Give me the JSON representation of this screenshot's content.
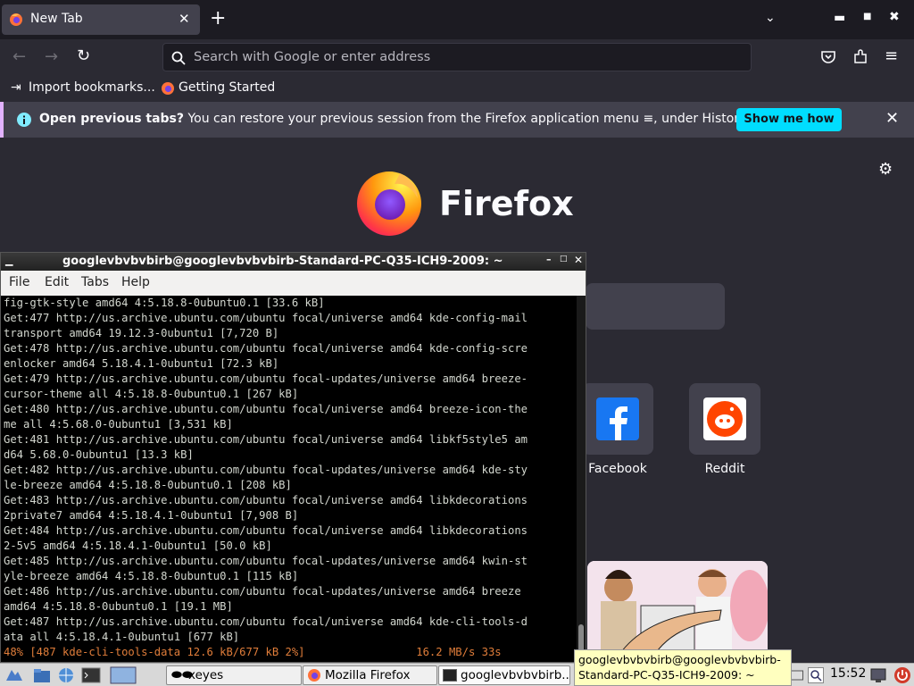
{
  "browser": {
    "tab_title": "New Tab",
    "search_placeholder": "Search with Google or enter address",
    "bookmarks": [
      "Import bookmarks...",
      "Getting Started"
    ],
    "notice": {
      "bold": "Open previous tabs?",
      "text": " You can restore your previous session from the Firefox application menu ≡, under History.",
      "button": "Show me how"
    },
    "brand": "Firefox",
    "shortcuts": [
      {
        "label": "Facebook"
      },
      {
        "label": "Reddit"
      }
    ]
  },
  "terminal": {
    "title": "googlevbvbvbirb@googlevbvbvbirb-Standard-PC-Q35-ICH9-2009: ~",
    "menu": [
      "File",
      "Edit",
      "Tabs",
      "Help"
    ],
    "lines": [
      "fig-gtk-style amd64 4:5.18.8-0ubuntu0.1 [33.6 kB]",
      "Get:477 http://us.archive.ubuntu.com/ubuntu focal/universe amd64 kde-config-mail",
      "transport amd64 19.12.3-0ubuntu1 [7,720 B]",
      "Get:478 http://us.archive.ubuntu.com/ubuntu focal/universe amd64 kde-config-scre",
      "enlocker amd64 5.18.4.1-0ubuntu1 [72.3 kB]",
      "Get:479 http://us.archive.ubuntu.com/ubuntu focal-updates/universe amd64 breeze-",
      "cursor-theme all 4:5.18.8-0ubuntu0.1 [267 kB]",
      "Get:480 http://us.archive.ubuntu.com/ubuntu focal/universe amd64 breeze-icon-the",
      "me all 4:5.68.0-0ubuntu1 [3,531 kB]",
      "Get:481 http://us.archive.ubuntu.com/ubuntu focal/universe amd64 libkf5style5 am",
      "d64 5.68.0-0ubuntu1 [13.3 kB]",
      "Get:482 http://us.archive.ubuntu.com/ubuntu focal-updates/universe amd64 kde-sty",
      "le-breeze amd64 4:5.18.8-0ubuntu0.1 [208 kB]",
      "Get:483 http://us.archive.ubuntu.com/ubuntu focal/universe amd64 libkdecorations",
      "2private7 amd64 4:5.18.4.1-0ubuntu1 [7,908 B]",
      "Get:484 http://us.archive.ubuntu.com/ubuntu focal/universe amd64 libkdecorations",
      "2-5v5 amd64 4:5.18.4.1-0ubuntu1 [50.0 kB]",
      "Get:485 http://us.archive.ubuntu.com/ubuntu focal-updates/universe amd64 kwin-st",
      "yle-breeze amd64 4:5.18.8-0ubuntu0.1 [115 kB]",
      "Get:486 http://us.archive.ubuntu.com/ubuntu focal-updates/universe amd64 breeze ",
      "amd64 4:5.18.8-0ubuntu0.1 [19.1 MB]",
      "Get:487 http://us.archive.ubuntu.com/ubuntu focal/universe amd64 kde-cli-tools-d",
      "ata all 4:5.18.4.1-0ubuntu1 [677 kB]"
    ],
    "progress_line": "48% [487 kde-cli-tools-data 12.6 kB/677 kB 2%]                 16.2 MB/s 33s"
  },
  "taskbar": {
    "tasks": [
      "xeyes",
      "Mozilla Firefox",
      "googlevbvbvbirb..."
    ],
    "clock": "15:52",
    "tooltip": "googlevbvbvbirb@googlevbvbvbirb-Standard-PC-Q35-ICH9-2009: ~"
  },
  "colors": {
    "accent": "#00ddff",
    "terminal_progress": "#e07d3a"
  }
}
